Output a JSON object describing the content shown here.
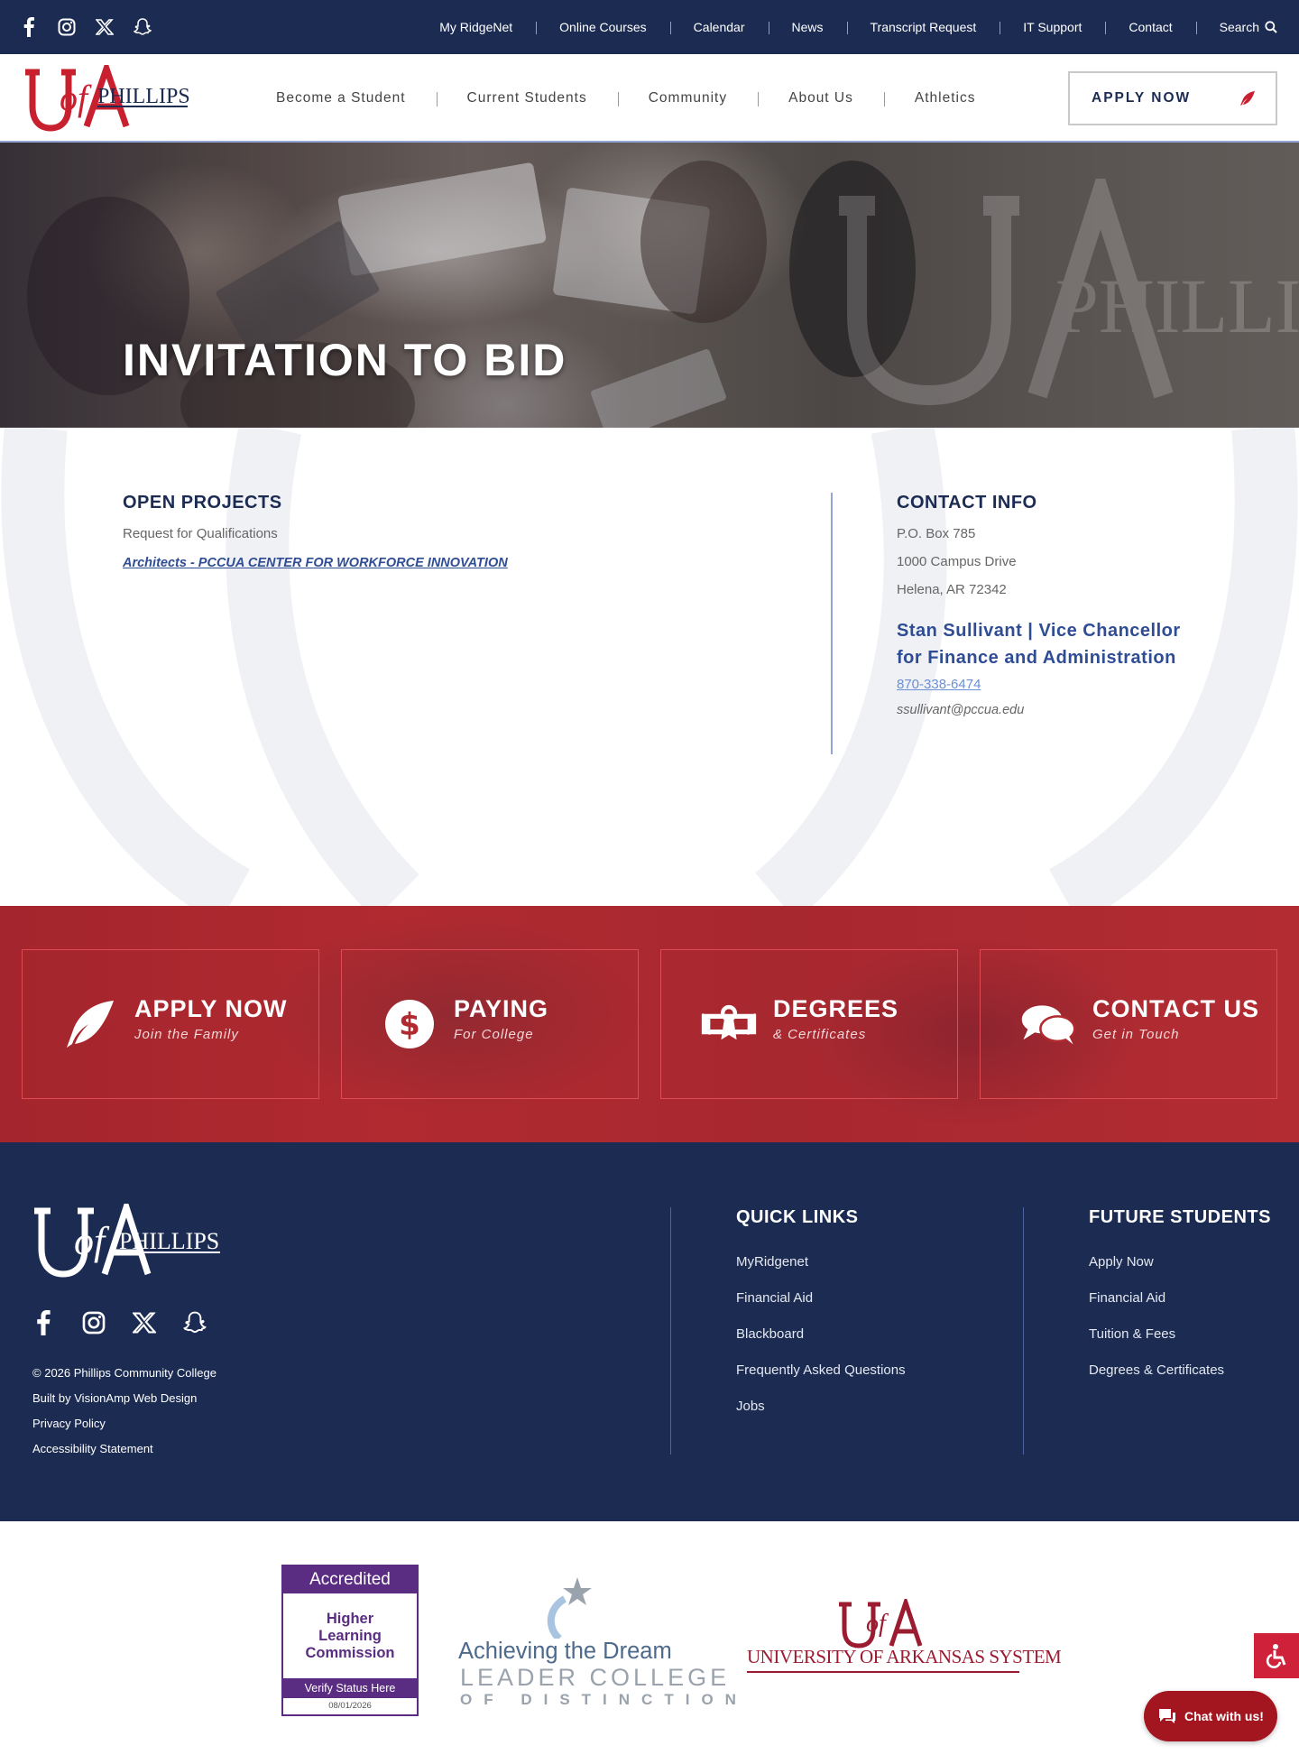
{
  "topbar": {
    "social_icons": [
      "facebook-icon",
      "instagram-icon",
      "x-icon",
      "snapchat-icon"
    ],
    "links": [
      "My RidgeNet",
      "Online Courses",
      "Calendar",
      "News",
      "Transcript Request",
      "IT Support",
      "Contact"
    ],
    "search_label": "Search"
  },
  "header": {
    "logo_text": "PHILLIPS",
    "nav": [
      "Become a Student",
      "Current Students",
      "Community",
      "About Us",
      "Athletics"
    ],
    "apply_label": "APPLY NOW"
  },
  "hero": {
    "title": "INVITATION TO BID"
  },
  "open_projects": {
    "heading": "OPEN PROJECTS",
    "subtitle": "Request for Qualifications",
    "project_link": "Architects - PCCUA CENTER FOR WORKFORCE INNOVATION"
  },
  "contact_info": {
    "heading": "CONTACT INFO",
    "address": [
      "P.O. Box 785",
      "1000 Campus Drive",
      "Helena, AR 72342"
    ],
    "person": "Stan Sullivant | Vice Chancellor for Finance and Administration",
    "phone": "870-338-6474",
    "email": "ssullivant@pccua.edu"
  },
  "cta": [
    {
      "title": "APPLY NOW",
      "subtitle": "Join the Family",
      "icon": "feather-icon"
    },
    {
      "title": "PAYING",
      "subtitle": "For College",
      "icon": "dollar-icon"
    },
    {
      "title": "DEGREES",
      "subtitle": "& Certificates",
      "icon": "diploma-icon"
    },
    {
      "title": "CONTACT US",
      "subtitle": "Get in Touch",
      "icon": "chat-bubbles-icon"
    }
  ],
  "footer": {
    "logo_text": "PHILLIPS",
    "copyright": "2026 Phillips Community College",
    "built_by": "Built by VisionAmp Web Design",
    "privacy": "Privacy Policy",
    "accessibility": "Accessibility Statement",
    "quick_links": {
      "heading": "QUICK LINKS",
      "items": [
        "MyRidgenet",
        "Financial Aid",
        "Blackboard",
        "Frequently Asked Questions",
        "Jobs"
      ]
    },
    "future_students": {
      "heading": "FUTURE STUDENTS",
      "items": [
        "Apply Now",
        "Financial Aid",
        "Tuition & Fees",
        "Degrees & Certificates"
      ]
    }
  },
  "accreditation": {
    "hlc_top": "Accredited",
    "hlc_line1": "Higher",
    "hlc_line2": "Learning",
    "hlc_line3": "Commission",
    "hlc_verify": "Verify Status Here",
    "hlc_date": "08/01/2026",
    "atd_line1": "Achieving the Dream",
    "atd_line2": "LEADER COLLEGE",
    "atd_line3": "OF DISTINCTION",
    "ua_system": "UNIVERSITY OF ARKANSAS SYSTEM"
  },
  "chat": {
    "label": "Chat with us!"
  },
  "colors": {
    "navy": "#1b2b52",
    "red": "#b02a30",
    "link_blue": "#2f4d95",
    "hlc_purple": "#5a2d82"
  }
}
